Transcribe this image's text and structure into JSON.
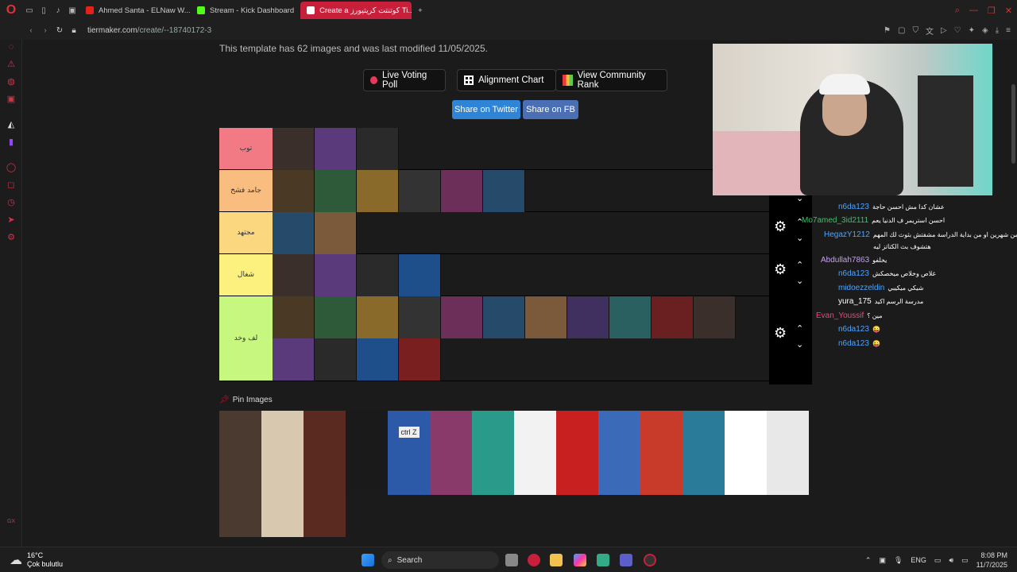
{
  "browser": {
    "tabs": [
      {
        "label": "Ahmed Santa - ELNaw W...",
        "color": "#e62117",
        "active": false
      },
      {
        "label": "Stream - Kick Dashboard",
        "color": "#53fc18",
        "active": false
      },
      {
        "label": "Create a كوتنتت كريتيورز Ti...",
        "color": "#c8203a",
        "active": true
      }
    ],
    "new_tab": "+",
    "url_host": "tiermaker.com",
    "url_path": "/create/--18740172-3"
  },
  "page": {
    "template_info": "This template has 62 images and was last modified 11/05/2025.",
    "buttons": {
      "live_voting": "Live Voting Poll",
      "alignment": "Alignment Chart",
      "community_rank": "View Community Rank",
      "share_twitter": "Share on Twitter",
      "share_fb": "Share on FB"
    },
    "tiers": [
      {
        "label": "توب",
        "color": "#f27a84",
        "count": 3
      },
      {
        "label": "جامد فشخ",
        "color": "#f9bd80",
        "count": 6
      },
      {
        "label": "مجتهد",
        "color": "#fbd87f",
        "count": 2
      },
      {
        "label": "شغال",
        "color": "#fcf07f",
        "count": 4
      },
      {
        "label": "لف وخد",
        "color": "#c8f77f",
        "count": 15
      }
    ],
    "pin_title": "Pin Images",
    "pin_count": 31,
    "ctrl_tile_text": "ctrl Z"
  },
  "chat": [
    {
      "user": "n6da123",
      "msg": "عشان كدا مش احسن حاجة",
      "color": "#4fa3ff"
    },
    {
      "user": "Mo7amed_3id2111",
      "msg": "احسن استريمر ف الدنيا يعم",
      "color": "#35c46b"
    },
    {
      "user": "HegazY1212",
      "msg": "اكتر من شهرين او من بداية الدراسة مشفتش بثوث لك المهم",
      "color": "#4fa3ff"
    },
    {
      "user": "",
      "msg": "هتشوف بث الكتاتز ليه",
      "color": "#ffffff"
    },
    {
      "user": "Abdullah7863",
      "msg": "يخلفو",
      "color": "#c99cff"
    },
    {
      "user": "n6da123",
      "msg": "غلاص وخلاص ميخصكش",
      "color": "#4fa3ff"
    },
    {
      "user": "midoezzeldin",
      "msg": "شيكي ميكيبي",
      "color": "#4fa3ff"
    },
    {
      "user": "yura_175",
      "msg": "مدرسة الرسم اكيد",
      "color": "#ffffff"
    },
    {
      "user": "Evan_Youssif",
      "msg": "مين ؟",
      "color": "#e84c7a"
    },
    {
      "user": "n6da123",
      "msg": "😜",
      "color": "#4fa3ff"
    },
    {
      "user": "n6da123",
      "msg": "😜",
      "color": "#4fa3ff"
    }
  ],
  "taskbar": {
    "temp": "16°C",
    "weather": "Çok bulutlu",
    "search": "Search",
    "lang": "ENG",
    "time": "8:08 PM",
    "date": "11/7/2025"
  }
}
